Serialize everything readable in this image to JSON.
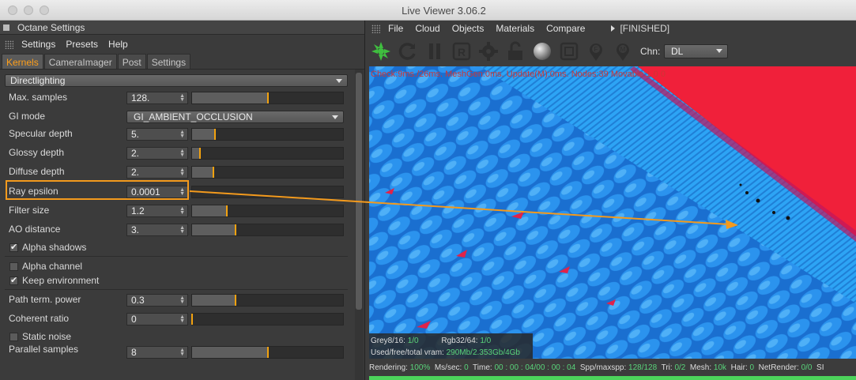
{
  "window": {
    "title": "Live Viewer 3.06.2"
  },
  "settings": {
    "panel_title": "Octane Settings",
    "menu": [
      "Settings",
      "Presets",
      "Help"
    ],
    "tabs": [
      "Kernels",
      "CameraImager",
      "Post",
      "Settings"
    ],
    "active_tab": "Kernels",
    "kernel": "Directlighting",
    "params": {
      "max_samples": {
        "label": "Max. samples",
        "value": "128.",
        "slider_fraction": 0.5
      },
      "gi_mode": {
        "label": "GI mode",
        "value": "GI_AMBIENT_OCCLUSION"
      },
      "specular_depth": {
        "label": "Specular depth",
        "value": "5.",
        "slider_fraction": 0.15
      },
      "glossy_depth": {
        "label": "Glossy depth",
        "value": "2.",
        "slider_fraction": 0.05
      },
      "diffuse_depth": {
        "label": "Diffuse depth",
        "value": "2.",
        "slider_fraction": 0.14
      },
      "ray_epsilon": {
        "label": "Ray epsilon",
        "value": "0.0001",
        "slider_fraction": 0.0
      },
      "filter_size": {
        "label": "Filter size",
        "value": "1.2",
        "slider_fraction": 0.23
      },
      "ao_distance": {
        "label": "AO distance",
        "value": "3.",
        "slider_fraction": 0.29
      },
      "alpha_shadows": {
        "label": "Alpha shadows",
        "checked": true
      },
      "alpha_channel": {
        "label": "Alpha channel",
        "checked": false
      },
      "keep_environment": {
        "label": "Keep environment",
        "checked": true
      },
      "path_term_power": {
        "label": "Path term. power",
        "value": "0.3",
        "slider_fraction": 0.29
      },
      "coherent_ratio": {
        "label": "Coherent ratio",
        "value": "0",
        "slider_fraction": 0.0
      },
      "static_noise": {
        "label": "Static noise",
        "checked": false
      },
      "parallel_samples": {
        "label": "Parallel samples",
        "value": "8",
        "slider_fraction": 0.5
      }
    }
  },
  "viewer": {
    "menu": [
      "File",
      "Cloud",
      "Objects",
      "Materials",
      "Compare"
    ],
    "status": "[FINISHED]",
    "toolbar_icons": [
      "octane-logo-icon",
      "refresh-icon",
      "pause-icon",
      "r-icon",
      "gear-icon",
      "lock-icon",
      "sphere-icon",
      "region-icon",
      "focus-pin-icon",
      "material-pin-icon"
    ],
    "channel_label": "Chn:",
    "channel_value": "DL",
    "stats_line": "Check:9ms./26ms. MeshGen:0ms. Update(M):0ms. Nodes:39 Movable:1 0 0",
    "info": {
      "grey_label": "Grey8/16:",
      "grey_value": "1/0",
      "rgb_label": "Rgb32/64:",
      "rgb_value": "1/0",
      "vram_label": "Used/free/total vram:",
      "vram_value": "290Mb/2.353Gb/4Gb"
    },
    "statusbar": {
      "rendering_label": "Rendering:",
      "rendering_value": "100%",
      "mssec_label": "Ms/sec:",
      "mssec_value": "0",
      "time_label": "Time:",
      "time_value": "00 : 00 : 04/00 : 00 : 04",
      "spp_label": "Spp/maxspp:",
      "spp_value": "128/128",
      "tri_label": "Tri:",
      "tri_value": "0/2",
      "mesh_label": "Mesh:",
      "mesh_value": "10k",
      "hair_label": "Hair:",
      "hair_value": "0",
      "netrender_label": "NetRender:",
      "netrender_value": "0/0",
      "tail": "SI"
    },
    "progress": 1.0
  },
  "colors": {
    "accent": "#f39a1d",
    "render_blue": "#1f8ee6",
    "render_red": "#f0203a",
    "progress": "#4cd35b"
  }
}
